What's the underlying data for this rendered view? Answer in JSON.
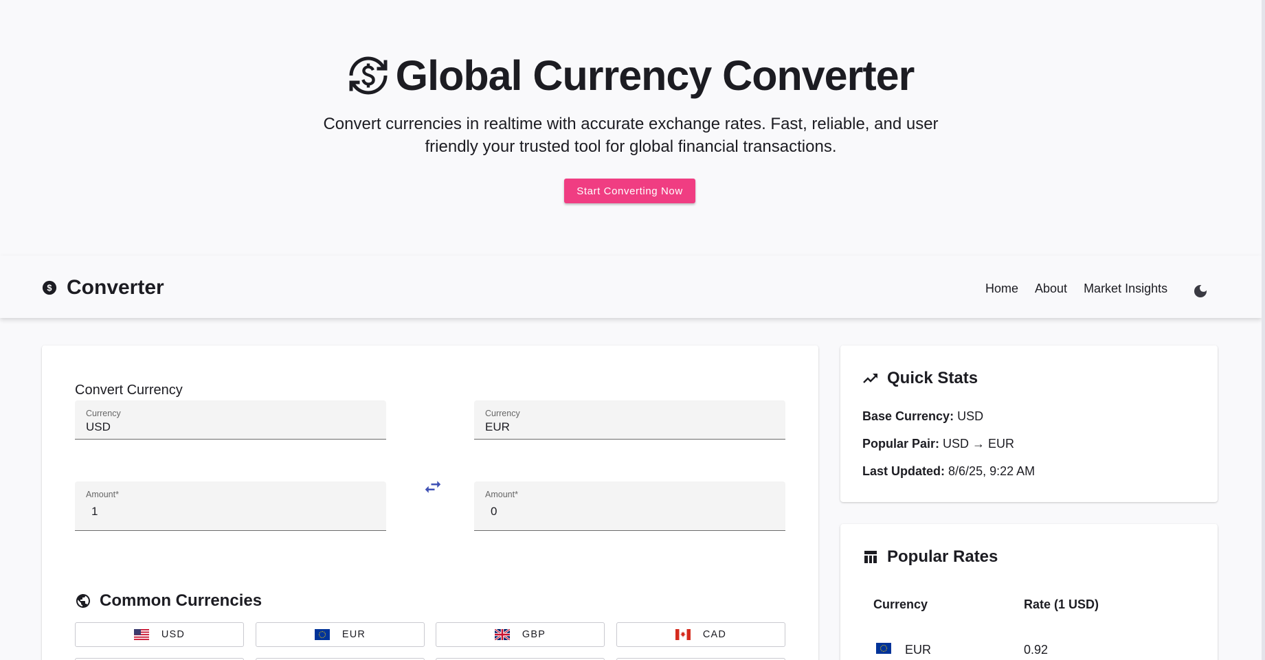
{
  "hero": {
    "title": "Global Currency Converter",
    "subtitle_line1": "Convert currencies in realtime with accurate exchange rates. Fast, reliable, and user",
    "subtitle_line2": "friendly your trusted tool for global financial transactions.",
    "cta_label": "Start Converting Now"
  },
  "navbar": {
    "brand": "Converter",
    "links": [
      "Home",
      "About",
      "Market Insights"
    ],
    "theme_icon": "moon-icon"
  },
  "converter": {
    "section_title": "Convert Currency",
    "from": {
      "currency_label": "Currency",
      "currency_value": "USD",
      "amount_label": "Amount*",
      "amount_value": "1"
    },
    "to": {
      "currency_label": "Currency",
      "currency_value": "EUR",
      "amount_label": "Amount*",
      "amount_value": "0"
    },
    "common_title": "Common Currencies",
    "common_currencies": [
      "USD",
      "EUR",
      "GBP",
      "CAD"
    ]
  },
  "quick_stats": {
    "title": "Quick Stats",
    "base_label": "Base Currency:",
    "base_value": "USD",
    "pair_label": "Popular Pair:",
    "pair_value": "USD → EUR",
    "updated_label": "Last Updated:",
    "updated_value": "8/6/25, 9:22 AM"
  },
  "popular_rates": {
    "title": "Popular Rates",
    "columns": [
      "Currency",
      "Rate (1 USD)"
    ],
    "rows": [
      {
        "currency": "EUR",
        "rate": "0.92"
      }
    ]
  },
  "colors": {
    "accent": "#f03d82",
    "swap": "#3f51b5",
    "text": "#1c1c22"
  }
}
